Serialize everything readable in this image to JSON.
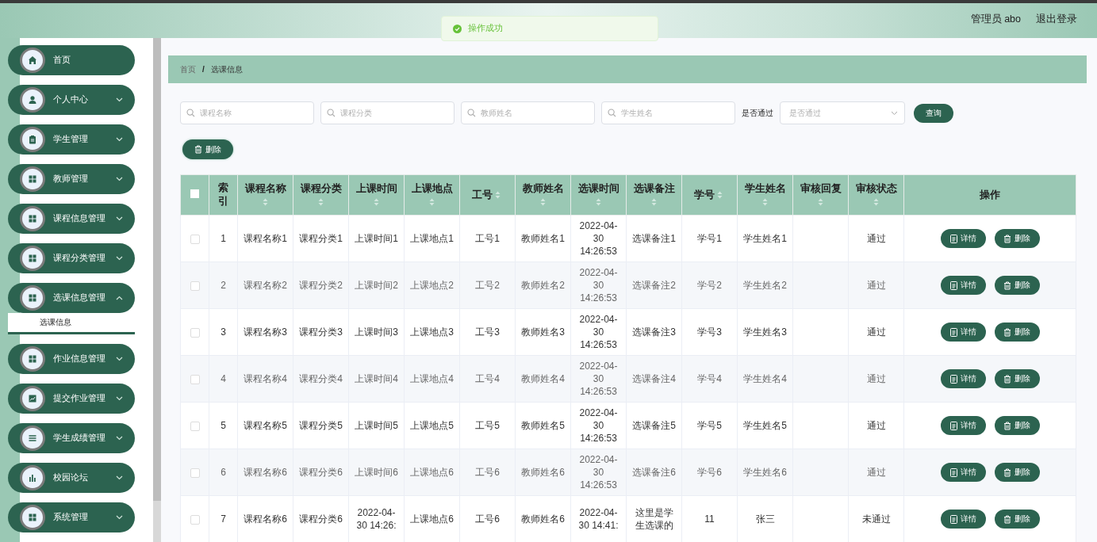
{
  "header": {
    "user": "管理员 abo",
    "logout": "退出登录"
  },
  "toast": {
    "message": "操作成功"
  },
  "sidebar": {
    "items": [
      {
        "label": "首页",
        "kind": "home"
      },
      {
        "label": "个人中心",
        "kind": "user",
        "expanded": false
      },
      {
        "label": "学生管理",
        "kind": "clipboard",
        "expanded": false
      },
      {
        "label": "教师管理",
        "kind": "grid",
        "expanded": false
      },
      {
        "label": "课程信息管理",
        "kind": "grid",
        "expanded": false
      },
      {
        "label": "课程分类管理",
        "kind": "grid",
        "expanded": false
      },
      {
        "label": "选课信息管理",
        "kind": "grid",
        "expanded": true,
        "children": [
          {
            "label": "选课信息",
            "selected": true
          }
        ]
      },
      {
        "label": "作业信息管理",
        "kind": "grid",
        "expanded": false
      },
      {
        "label": "提交作业管理",
        "kind": "chart",
        "expanded": false
      },
      {
        "label": "学生成绩管理",
        "kind": "list",
        "expanded": false
      },
      {
        "label": "校园论坛",
        "kind": "bars",
        "expanded": false
      },
      {
        "label": "系统管理",
        "kind": "grid",
        "expanded": false
      }
    ]
  },
  "breadcrumb": {
    "items": [
      "首页",
      "选课信息"
    ],
    "separator": "/"
  },
  "filters": {
    "fields": [
      {
        "placeholder": "课程名称"
      },
      {
        "placeholder": "课程分类"
      },
      {
        "placeholder": "教师姓名"
      },
      {
        "placeholder": "学生姓名"
      }
    ],
    "pass_label": "是否通过",
    "pass_select": {
      "placeholder": "是否通过"
    },
    "query_button": "查询"
  },
  "delete_button": "删除",
  "table": {
    "all_checked": false,
    "columns": [
      {
        "label": "索引",
        "sortable": false
      },
      {
        "label": "课程名称",
        "sortable": true
      },
      {
        "label": "课程分类",
        "sortable": true
      },
      {
        "label": "上课时间",
        "sortable": true
      },
      {
        "label": "上课地点",
        "sortable": true
      },
      {
        "label": "工号",
        "sortable": true
      },
      {
        "label": "教师姓名",
        "sortable": true
      },
      {
        "label": "选课时间",
        "sortable": true
      },
      {
        "label": "选课备注",
        "sortable": true
      },
      {
        "label": "学号",
        "sortable": true
      },
      {
        "label": "学生姓名",
        "sortable": true
      },
      {
        "label": "审核回复",
        "sortable": true
      },
      {
        "label": "审核状态",
        "sortable": true
      },
      {
        "label": "操作",
        "sortable": false
      }
    ],
    "rows": [
      {
        "selected": false,
        "cells": [
          "1",
          "课程名称1",
          "课程分类1",
          "上课时间1",
          "上课地点1",
          "工号1",
          "教师姓名1",
          "2022-04-30 14:26:53",
          "选课备注1",
          "学号1",
          "学生姓名1",
          "",
          "通过"
        ],
        "actions": [
          "详情",
          "删除"
        ]
      },
      {
        "selected": false,
        "cells": [
          "2",
          "课程名称2",
          "课程分类2",
          "上课时间2",
          "上课地点2",
          "工号2",
          "教师姓名2",
          "2022-04-30 14:26:53",
          "选课备注2",
          "学号2",
          "学生姓名2",
          "",
          "通过"
        ],
        "actions": [
          "详情",
          "删除"
        ]
      },
      {
        "selected": false,
        "cells": [
          "3",
          "课程名称3",
          "课程分类3",
          "上课时间3",
          "上课地点3",
          "工号3",
          "教师姓名3",
          "2022-04-30 14:26:53",
          "选课备注3",
          "学号3",
          "学生姓名3",
          "",
          "通过"
        ],
        "actions": [
          "详情",
          "删除"
        ]
      },
      {
        "selected": false,
        "cells": [
          "4",
          "课程名称4",
          "课程分类4",
          "上课时间4",
          "上课地点4",
          "工号4",
          "教师姓名4",
          "2022-04-30 14:26:53",
          "选课备注4",
          "学号4",
          "学生姓名4",
          "",
          "通过"
        ],
        "actions": [
          "详情",
          "删除"
        ]
      },
      {
        "selected": false,
        "cells": [
          "5",
          "课程名称5",
          "课程分类5",
          "上课时间5",
          "上课地点5",
          "工号5",
          "教师姓名5",
          "2022-04-30 14:26:53",
          "选课备注5",
          "学号5",
          "学生姓名5",
          "",
          "通过"
        ],
        "actions": [
          "详情",
          "删除"
        ]
      },
      {
        "selected": false,
        "cells": [
          "6",
          "课程名称6",
          "课程分类6",
          "上课时间6",
          "上课地点6",
          "工号6",
          "教师姓名6",
          "2022-04-30 14:26:53",
          "选课备注6",
          "学号6",
          "学生姓名6",
          "",
          "通过"
        ],
        "actions": [
          "详情",
          "删除"
        ]
      },
      {
        "selected": false,
        "cells": [
          "7",
          "课程名称6",
          "课程分类6",
          "2022-04-30 14:26:",
          "上课地点6",
          "工号6",
          "教师姓名6",
          "2022-04-30 14:41:",
          "这里是学生选课的",
          "11",
          "张三",
          "",
          "未通过"
        ],
        "actions": [
          "详情",
          "删除"
        ]
      }
    ]
  }
}
